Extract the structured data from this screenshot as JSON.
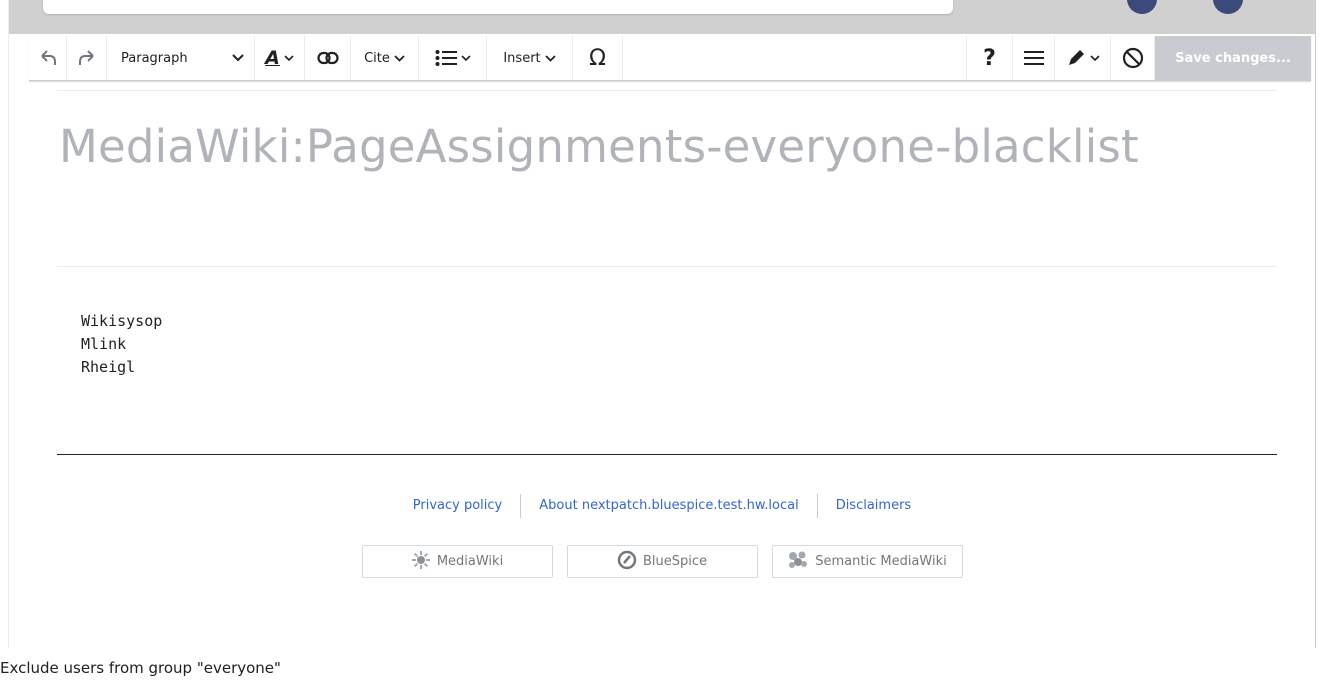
{
  "toolbar": {
    "undo": "undo-icon",
    "redo": "redo-icon",
    "format_value": "Paragraph",
    "text_style": "text-style-icon",
    "link": "link-icon",
    "cite_label": "Cite",
    "list": "list-icon",
    "insert_label": "Insert",
    "special_char_label": "Ω",
    "help_label": "?",
    "save_label": "Save changes..."
  },
  "page": {
    "title": "MediaWiki:PageAssignments-everyone-blacklist",
    "content_lines": [
      "Wikisysop",
      "Mlink",
      "Rheigl"
    ]
  },
  "footer": {
    "links": [
      "Privacy policy",
      "About nextpatch.bluespice.test.hw.local",
      "Disclaimers"
    ],
    "badges": [
      "MediaWiki",
      "BlueSpice",
      "Semantic MediaWiki"
    ]
  },
  "caption": "Exclude users from group \"everyone\""
}
